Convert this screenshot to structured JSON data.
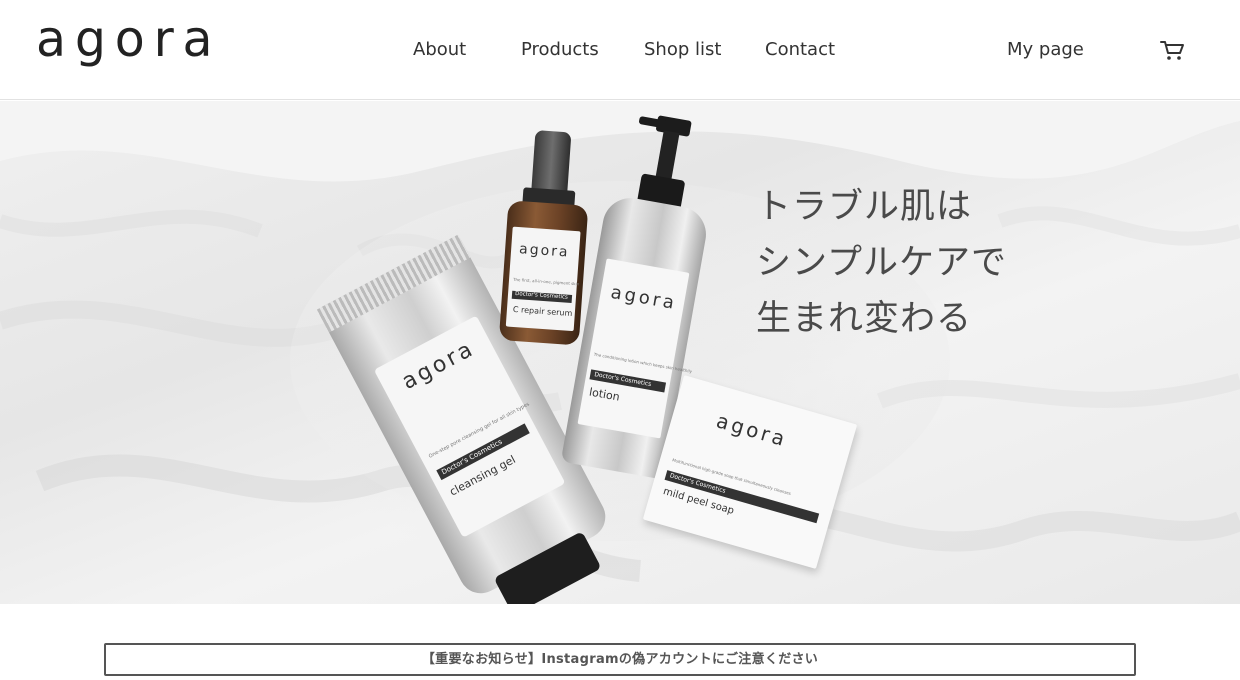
{
  "header": {
    "logo_text": "agora",
    "nav": {
      "about": "About",
      "products": "Products",
      "shop_list": "Shop list",
      "contact": "Contact",
      "my_page": "My page"
    },
    "cart_icon": "cart-icon"
  },
  "hero": {
    "headline": {
      "line1": "トラブル肌は",
      "line2": "シンプルケアで",
      "line3": "生まれ変わる"
    },
    "products": {
      "serum": {
        "brand": "agora",
        "desc": "The first, all-in-one, pigment skin",
        "line": "Doctor's Cosmetics",
        "name": "C repair serum"
      },
      "lotion": {
        "brand": "agora",
        "desc": "The conditioning lotion which keeps skin healthily",
        "line": "Doctor's Cosmetics",
        "name": "lotion"
      },
      "gel": {
        "brand": "agora",
        "desc": "One-step pore cleansing gel for all skin types",
        "line": "Doctor's Cosmetics",
        "name": "cleansing gel"
      },
      "soap": {
        "brand": "agora",
        "desc": "Multifunctional high-grade soap that simultaneously cleanses",
        "line": "Doctor's Cosmetics",
        "name": "mild peel soap"
      }
    }
  },
  "notice": {
    "text": "【重要なお知らせ】Instagramの偽アカウントにご注意ください"
  },
  "colors": {
    "text": "#333333",
    "border": "#555555",
    "hero_bg": "#ececec"
  }
}
